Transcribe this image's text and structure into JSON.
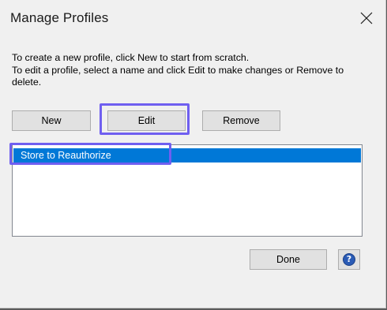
{
  "dialog": {
    "title": "Manage Profiles",
    "close_icon": "close-icon",
    "description": "To create a new profile, click New to start from scratch.\nTo edit a profile, select a name and click Edit to make changes or Remove to delete."
  },
  "buttons": {
    "new_label": "New",
    "edit_label": "Edit",
    "remove_label": "Remove",
    "done_label": "Done",
    "help_glyph": "?",
    "help_icon": "help-icon"
  },
  "profiles": {
    "items": [
      {
        "label": "Store to Reauthorize",
        "selected": true
      }
    ]
  },
  "colors": {
    "selection": "#0078d7",
    "highlight_annotation": "#6f5ff0",
    "dialog_background": "#f0f0f0"
  }
}
